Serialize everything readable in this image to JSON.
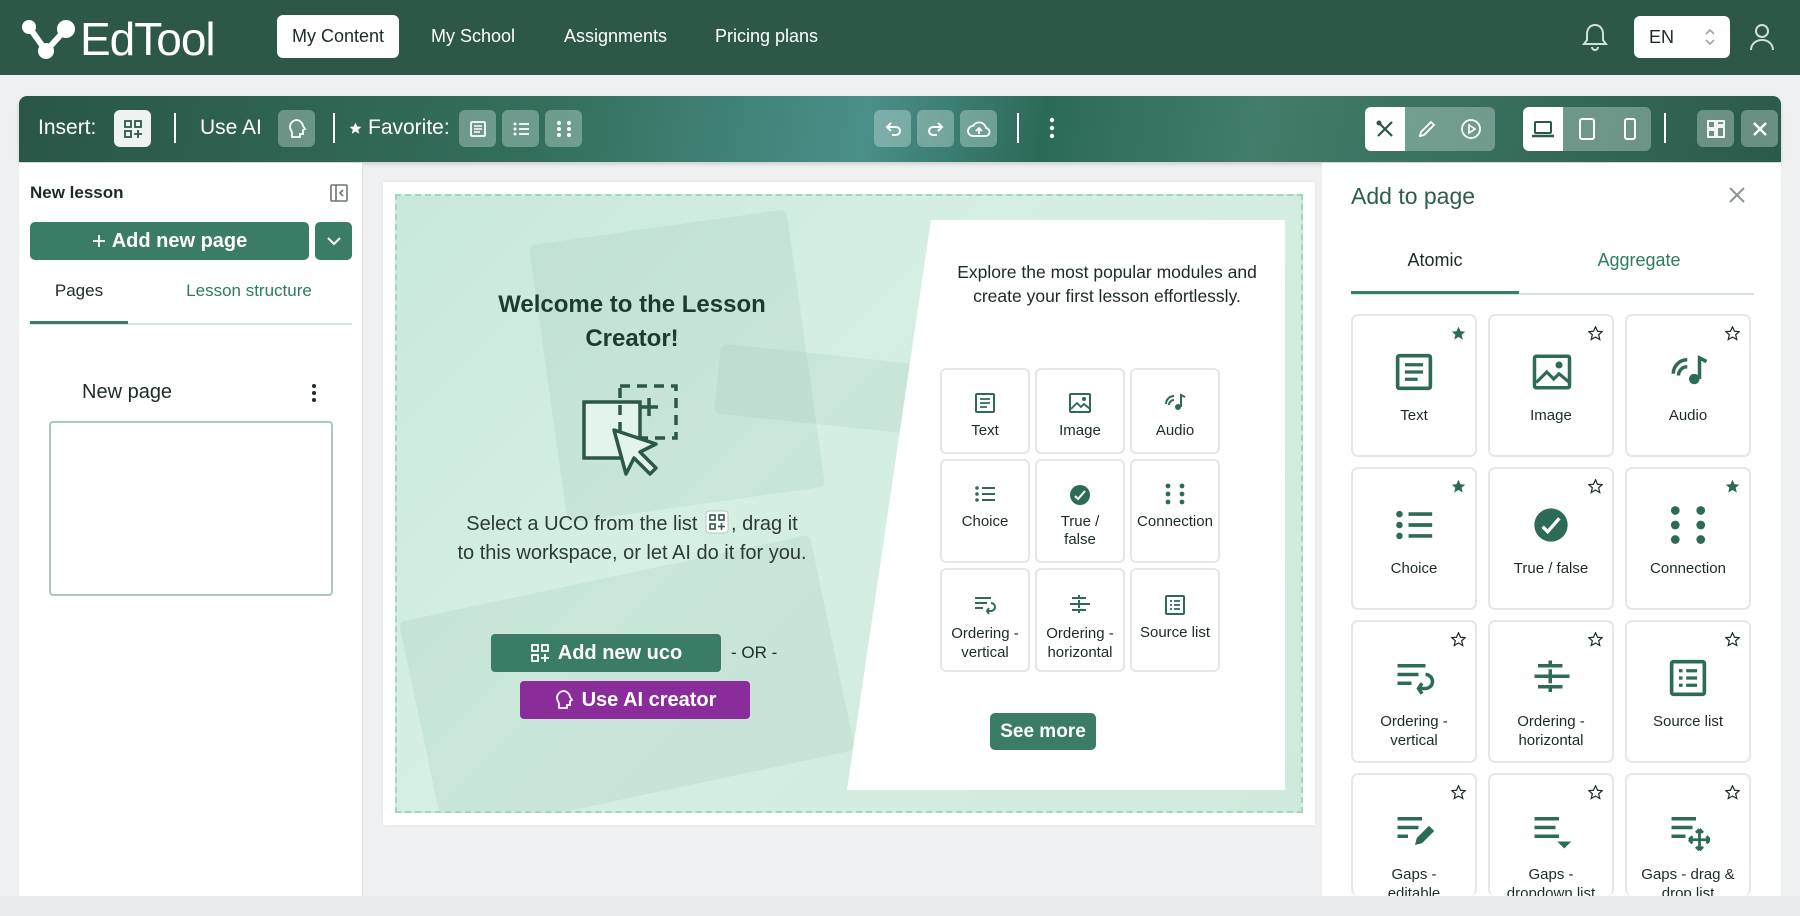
{
  "app": {
    "logo_text": "EdTool"
  },
  "nav": {
    "items": [
      "My Content",
      "My School",
      "Assignments",
      "Pricing plans"
    ],
    "language": "EN"
  },
  "toolbar": {
    "insert_label": "Insert:",
    "use_ai_label": "Use AI",
    "favorite_label": "Favorite:"
  },
  "left_panel": {
    "title": "New lesson",
    "add_page_label": "Add new page",
    "tabs": [
      "Pages",
      "Lesson structure"
    ],
    "page_name": "New page"
  },
  "workspace": {
    "welcome_title": "Welcome to the Lesson Creator!",
    "welcome_text_before": "Select a UCO from the list",
    "welcome_text_after": ", drag it to this workspace, or let AI do it for you.",
    "add_uco_label": "Add new uco",
    "or_text": "- OR -",
    "ai_creator_label": "Use AI creator",
    "explore_text": "Explore the most popular modules and create your first lesson effortlessly.",
    "modules": [
      "Text",
      "Image",
      "Audio",
      "Choice",
      "True / false",
      "Connection",
      "Ordering - vertical",
      "Ordering - horizontal",
      "Source list"
    ],
    "see_more_label": "See more"
  },
  "right_panel": {
    "title": "Add to page",
    "tabs": [
      "Atomic",
      "Aggregate"
    ],
    "tiles": [
      {
        "label": "Text",
        "favorite": true
      },
      {
        "label": "Image",
        "favorite": false
      },
      {
        "label": "Audio",
        "favorite": false
      },
      {
        "label": "Choice",
        "favorite": true
      },
      {
        "label": "True / false",
        "favorite": false
      },
      {
        "label": "Connection",
        "favorite": true
      },
      {
        "label": "Ordering - vertical",
        "favorite": false
      },
      {
        "label": "Ordering - horizontal",
        "favorite": false
      },
      {
        "label": "Source list",
        "favorite": false
      },
      {
        "label": "Gaps - editable",
        "favorite": false
      },
      {
        "label": "Gaps - dropdown list",
        "favorite": false
      },
      {
        "label": "Gaps - drag & drop list",
        "favorite": false
      }
    ]
  },
  "colors": {
    "nav_bg": "#2d5848",
    "accent": "#3b7c67",
    "ai_purple": "#8a2d9a",
    "workspace_bg": "#cfeadc"
  }
}
